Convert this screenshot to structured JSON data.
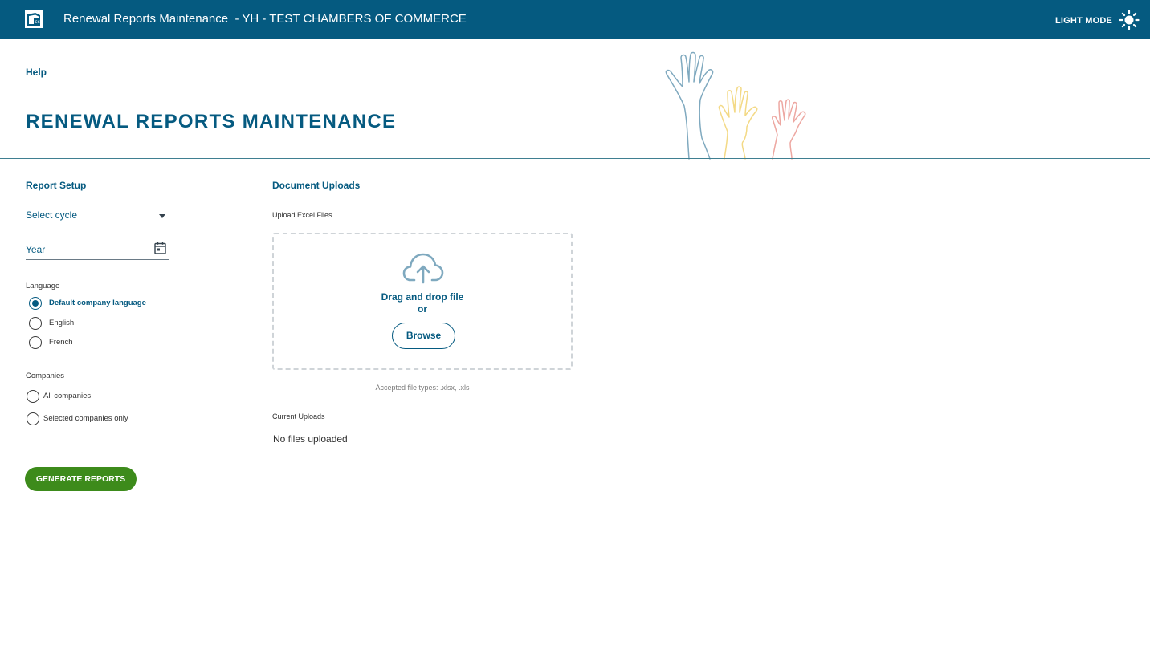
{
  "header": {
    "app_title": "Renewal Reports Maintenance  - YH - TEST CHAMBERS OF COMMERCE",
    "mode_label": "LIGHT MODE",
    "logo_icon": "chamber-logo-icon",
    "theme_icon": "sun-icon",
    "background_color": "#055a80"
  },
  "page": {
    "help_label": "Help",
    "title": "RENEWAL REPORTS MAINTENANCE"
  },
  "report_setup": {
    "section_title": "Report Setup",
    "cycle_placeholder": "Select cycle",
    "year_placeholder": "Year",
    "language": {
      "label": "Language",
      "options": [
        {
          "label": "Default company language",
          "selected": true
        },
        {
          "label": "English",
          "selected": false
        },
        {
          "label": "French",
          "selected": false
        }
      ]
    },
    "companies": {
      "label": "Companies",
      "options": [
        {
          "label": "All companies",
          "selected": false
        },
        {
          "label": "Selected companies only",
          "selected": false
        }
      ]
    },
    "generate_label": "GENERATE REPORTS",
    "generate_color": "#3d8b1b"
  },
  "document_uploads": {
    "section_title": "Document Uploads",
    "upload_label": "Upload Excel Files",
    "drag_text": "Drag and drop file",
    "or_text": "or",
    "browse_label": "Browse",
    "accepted_types": "Accepted file types: .xlsx, .xls",
    "current_uploads_label": "Current Uploads",
    "empty_text": "No files uploaded"
  }
}
